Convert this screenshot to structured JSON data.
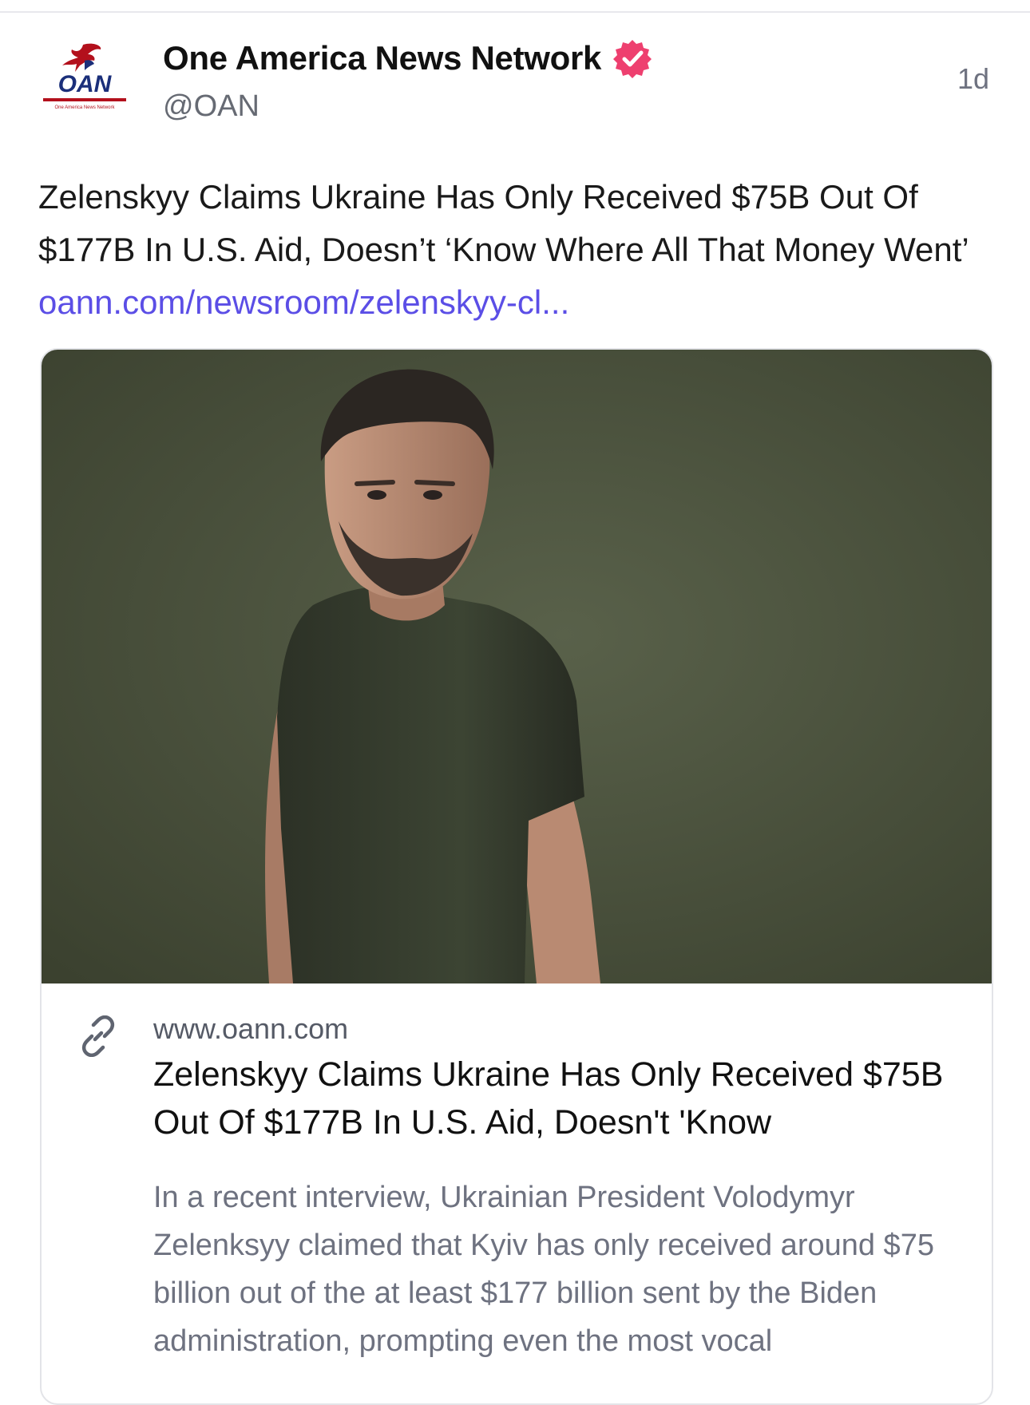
{
  "post": {
    "author": {
      "display_name": "One America News Network",
      "handle": "@OAN",
      "verified": true,
      "avatar_text": "OAN",
      "avatar_subtext": "One America News Network"
    },
    "timestamp": "1d",
    "text": "Zelenskyy Claims Ukraine Has Only Received $75B Out Of $177B In U.S. Aid, Doesn’t ‘Know Where All That Money Went’",
    "link_text": "oann.com/newsroom/zelenskyy-cl...",
    "link_card": {
      "domain": "www.oann.com",
      "title": "Zelenskyy Claims Ukraine Has Only Received $75B Out Of $177B In U.S. Aid, Doesn't 'Know",
      "description": "In a recent interview, Ukrainian President Volodymyr Zelenksyy claimed that Kyiv has only received around $75 billion out of the at least $177 billion sent by the Biden administration, prompting even the most vocal"
    }
  },
  "icons": {
    "verified": "verified-badge-icon",
    "link": "link-chain-icon"
  },
  "colors": {
    "link": "#5b4ee6",
    "verified_badge": "#ee3f6f",
    "logo_blue": "#1b2f7a",
    "logo_red": "#b3101c"
  }
}
